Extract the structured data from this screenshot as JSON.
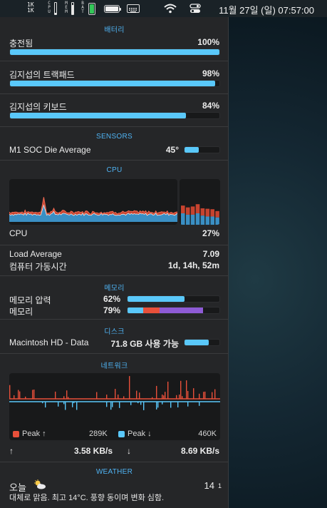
{
  "menubar": {
    "net_up": "1K",
    "net_down": "1K",
    "labels": [
      "CPU",
      "MEM",
      "BAT"
    ],
    "cpu_level": 0.15,
    "mem_level": 0.8,
    "battery_level": 1.0,
    "clock": "11월 27일 (일) 07:57:00",
    "icons": [
      "battery-icon",
      "keyboard-icon",
      "wifi-icon",
      "control-center-icon"
    ]
  },
  "battery_section": {
    "title": "배터리",
    "items": [
      {
        "label": "충전됨",
        "value": "100%",
        "level": 1.0
      },
      {
        "label": "김지섭의 트랙패드",
        "value": "98%",
        "level": 0.98
      },
      {
        "label": "김지섭의 키보드",
        "value": "84%",
        "level": 0.84
      }
    ]
  },
  "sensors": {
    "title": "SENSORS",
    "label": "M1 SOC Die Average",
    "value": "45°",
    "level": 0.4
  },
  "cpu": {
    "title": "CPU",
    "label": "CPU",
    "value": "27%",
    "load_label": "Load Average",
    "load_value": "7.09",
    "uptime_label": "컴퓨터 가동시간",
    "uptime_value": "1d, 14h, 52m",
    "core_bars": [
      0.42,
      0.38,
      0.4,
      0.45,
      0.36,
      0.35,
      0.34,
      0.3
    ],
    "core_user": [
      0.25,
      0.22,
      0.22,
      0.25,
      0.2,
      0.18,
      0.18,
      0.16
    ]
  },
  "memory": {
    "title": "메모리",
    "pressure_label": "메모리 압력",
    "pressure_value": "62%",
    "pressure_level": 0.62,
    "memory_label": "메모리",
    "memory_value": "79%",
    "memory_segments": [
      {
        "level": 0.17,
        "color": "#5ac8fa"
      },
      {
        "level": 0.18,
        "color": "#e8503a"
      },
      {
        "level": 0.47,
        "color": "#8e5bd6"
      }
    ]
  },
  "disk": {
    "title": "디스크",
    "label": "Macintosh HD - Data",
    "value": "71.8 GB 사용 가능",
    "level": 0.7
  },
  "network": {
    "title": "네트워크",
    "peak_up_label": "Peak ↑",
    "peak_up_value": "289K",
    "peak_down_label": "Peak ↓",
    "peak_down_value": "460K",
    "up_arrow": "↑",
    "up_rate": "3.58 KB/s",
    "down_arrow": "↓",
    "down_rate": "8.69 KB/s",
    "colors": {
      "up": "#e8503a",
      "down": "#5ac8fa"
    }
  },
  "weather": {
    "title": "WEATHER",
    "day": "오늘",
    "icon": "partly-cloudy-icon",
    "temp": "14",
    "temp_low": "1",
    "description": "대체로 맑음. 최고 14°C. 풍향 동이며 변화 심함."
  }
}
